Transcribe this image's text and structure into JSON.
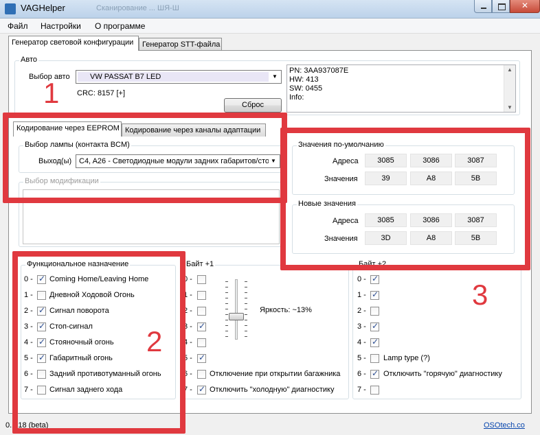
{
  "window": {
    "title": "VAGHelper",
    "title_ghost": "Сканирование ...           ШЯ-Ш"
  },
  "menu": [
    "Файл",
    "Настройки",
    "О программе"
  ],
  "tabs": [
    {
      "label": "Генератор световой конфигурации",
      "active": true
    },
    {
      "label": "Генератор STT-файла",
      "active": false
    }
  ],
  "auto": {
    "group_label": "Авто",
    "select_label": "Выбор авто",
    "selected_car": "VW PASSAT B7 LED",
    "crc": "CRC: 8157 [+]",
    "reset_button": "Сброс",
    "info_lines": [
      "PN: 3AA937087E",
      "HW: 413",
      "SW: 0455",
      "Info:"
    ]
  },
  "subtabs": [
    {
      "label": "Кодирование через EEPROM",
      "active": true
    },
    {
      "label": "Кодирование через каналы адаптации",
      "active": false
    }
  ],
  "lamp": {
    "group_label": "Выбор лампы (контакта BCM)",
    "output_label": "Выход(ы)",
    "output_value": "C4, A26 - Светодиодные модули задних габаритов/сто"
  },
  "modification": {
    "group_label": "Выбор модификации"
  },
  "defaults": {
    "group_label": "Значения по-умолчанию",
    "addr_label": "Адреса",
    "val_label": "Значения",
    "addresses": [
      "3085",
      "3086",
      "3087"
    ],
    "values": [
      "39",
      "A8",
      "5B"
    ]
  },
  "new_values": {
    "group_label": "Новые значения",
    "addr_label": "Адреса",
    "val_label": "Значения",
    "addresses": [
      "3085",
      "3086",
      "3087"
    ],
    "values": [
      "3D",
      "A8",
      "5B"
    ]
  },
  "functional": {
    "group_label": "Функциональное назначение",
    "items": [
      {
        "idx": "0 -",
        "label": "Coming Home/Leaving Home",
        "checked": true
      },
      {
        "idx": "1 -",
        "label": "Дневной Ходовой Огонь",
        "checked": false
      },
      {
        "idx": "2 -",
        "label": "Сигнал поворота",
        "checked": true
      },
      {
        "idx": "3 -",
        "label": "Стоп-сигнал",
        "checked": true
      },
      {
        "idx": "4 -",
        "label": "Стояночный огонь",
        "checked": true
      },
      {
        "idx": "5 -",
        "label": "Габаритный огонь",
        "checked": true
      },
      {
        "idx": "6 -",
        "label": "Задний противотуманный огонь",
        "checked": false
      },
      {
        "idx": "7 -",
        "label": "Сигнал заднего хода",
        "checked": false
      }
    ]
  },
  "byte1": {
    "group_label": "Байт +1",
    "brightness": "Яркость: ~13%",
    "slider_level_percent": 13,
    "items": [
      {
        "idx": "0 -",
        "label": "",
        "checked": false
      },
      {
        "idx": "1 -",
        "label": "",
        "checked": false
      },
      {
        "idx": "2 -",
        "label": "",
        "checked": false
      },
      {
        "idx": "3 -",
        "label": "",
        "checked": true
      },
      {
        "idx": "4 -",
        "label": "",
        "checked": false
      },
      {
        "idx": "5 -",
        "label": "",
        "checked": true
      },
      {
        "idx": "6 -",
        "label": "Отключение при открытии багажника",
        "checked": false
      },
      {
        "idx": "7 -",
        "label": "Отключить \"холодную\" диагностику",
        "checked": true
      }
    ]
  },
  "byte2": {
    "group_label": "Байт +2",
    "items": [
      {
        "idx": "0 -",
        "label": "",
        "checked": true
      },
      {
        "idx": "1 -",
        "label": "",
        "checked": true
      },
      {
        "idx": "2 -",
        "label": "",
        "checked": false
      },
      {
        "idx": "3 -",
        "label": "",
        "checked": true
      },
      {
        "idx": "4 -",
        "label": "",
        "checked": true
      },
      {
        "idx": "5 -",
        "label": "Lamp type (?)",
        "checked": false
      },
      {
        "idx": "6 -",
        "label": "Отключить \"горячую\" диагностику",
        "checked": true
      },
      {
        "idx": "7 -",
        "label": "",
        "checked": false
      }
    ]
  },
  "status": {
    "version": "0.1.18 (beta)",
    "link": "OSOtech.co"
  },
  "annotations": [
    "1",
    "2",
    "3"
  ],
  "colors": {
    "annotation_red": "#e0393f",
    "combo_highlight": "#e9e6f6"
  }
}
